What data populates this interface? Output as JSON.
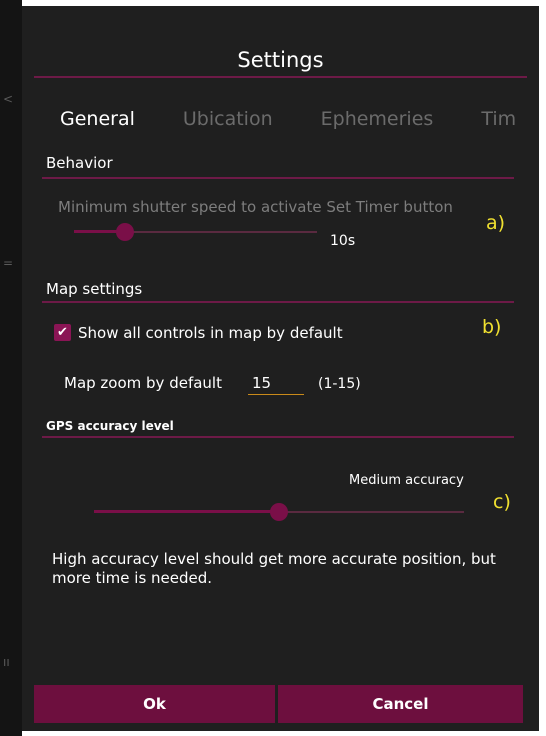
{
  "dialog": {
    "title": "Settings"
  },
  "tabs": [
    {
      "label": "General",
      "active": true
    },
    {
      "label": "Ubication",
      "active": false
    },
    {
      "label": "Ephemeries",
      "active": false
    },
    {
      "label": "Tim",
      "active": false
    }
  ],
  "behavior": {
    "section_title": "Behavior",
    "description": "Minimum shutter speed to activate Set Timer button",
    "slider_value": "10s",
    "slider_level": 0.21,
    "annotation": "a)"
  },
  "map_settings": {
    "section_title": "Map settings",
    "show_controls_label": "Show all controls in map by default",
    "show_controls_checked": true,
    "checkmark": "✔",
    "zoom_label": "Map zoom by default",
    "zoom_value": "15",
    "zoom_range": "(1-15)",
    "annotation": "b)"
  },
  "gps": {
    "section_title": "GPS accuracy level",
    "accuracy_label": "Medium accuracy",
    "slider_level": 0.5,
    "info_text": "High accuracy level should get more accurate position, but more time is needed.",
    "annotation": "c)"
  },
  "buttons": {
    "ok_label": "Ok",
    "cancel_label": "Cancel"
  },
  "colors": {
    "accent": "#6d1a47",
    "button": "#6d0f3e",
    "dialog_bg": "#1f1f1f",
    "annotation": "#f0e030",
    "input_underline": "#c98a1a"
  }
}
